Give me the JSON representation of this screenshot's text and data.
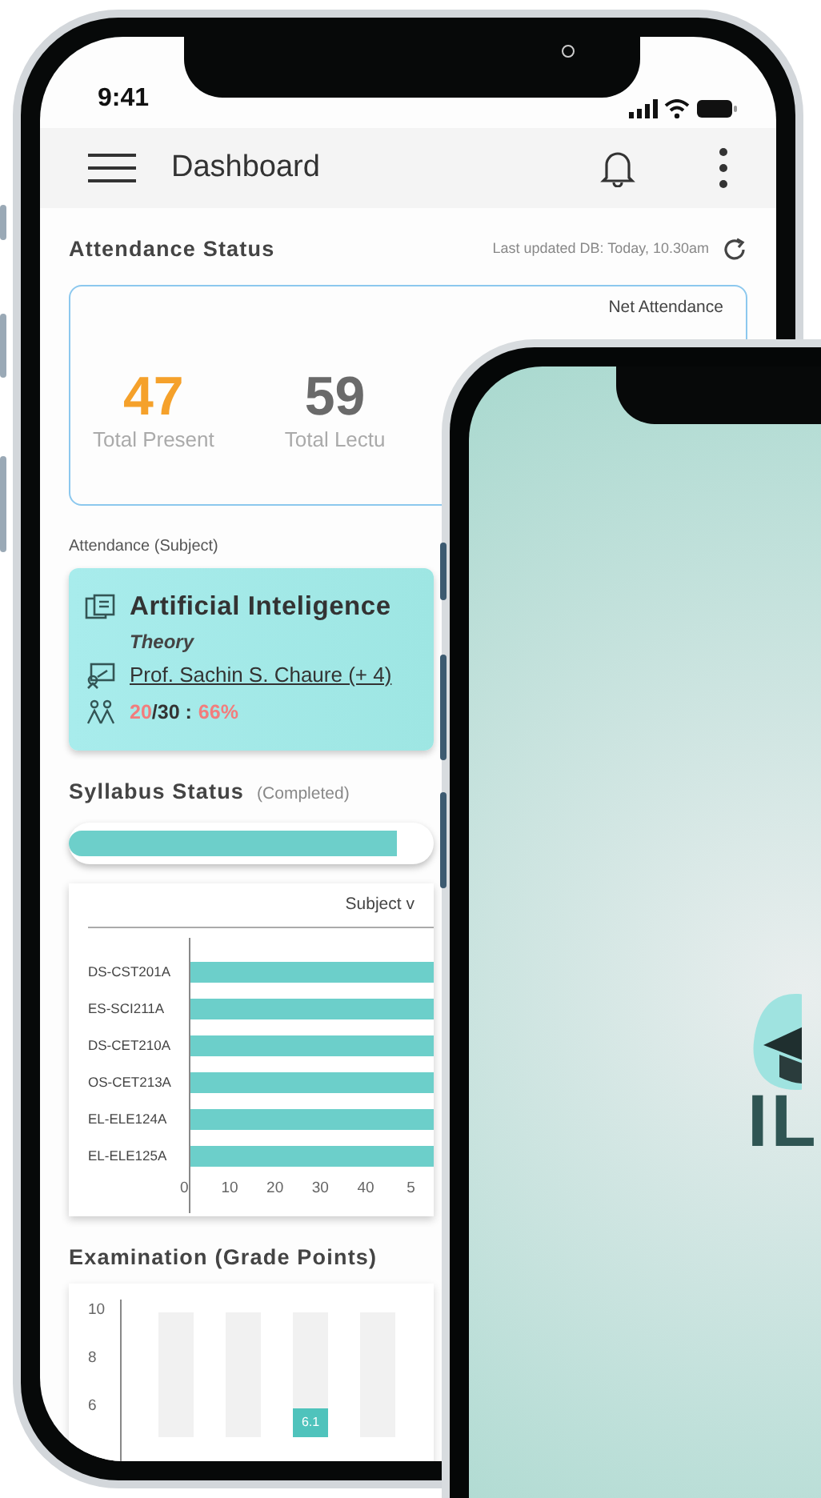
{
  "status_bar": {
    "time": "9:41"
  },
  "app_bar": {
    "title": "Dashboard"
  },
  "attendance_status": {
    "title": "Attendance Status",
    "last_updated": "Last updated DB: Today, 10.30am",
    "card_heading": "Net Attendance",
    "stats": [
      {
        "kind": "present",
        "value": "47",
        "label": "Total Present"
      },
      {
        "kind": "total",
        "value": "59",
        "label": "Total Lectu"
      }
    ]
  },
  "subject_attendance": {
    "heading": "Attendance (Subject)",
    "subject": "Artificial Inteligence",
    "type": "Theory",
    "teacher": "Prof. Sachin S. Chaure (+ 4)",
    "attended": "20",
    "total": "/30 :",
    "percent": "66%"
  },
  "syllabus": {
    "title": "Syllabus Status",
    "note": "(Completed)",
    "level": 0.9
  },
  "subject_chart": {
    "title": "Subject v",
    "categories": [
      "DS-CST201A",
      "ES-SCI211A",
      "DS-CET210A",
      "OS-CET213A",
      "EL-ELE124A",
      "EL-ELE125A"
    ],
    "ticks": [
      "0",
      "10",
      "20",
      "30",
      "40",
      "5"
    ]
  },
  "exam": {
    "title": "Examination (Grade Points)",
    "yticks": [
      "10",
      "8",
      "6"
    ],
    "bars": [
      {
        "kind": "empty"
      },
      {
        "kind": "empty"
      },
      {
        "kind": "value",
        "text": "6.1"
      },
      {
        "kind": "empty"
      }
    ]
  },
  "splash": {
    "logo_text": "IL"
  }
}
